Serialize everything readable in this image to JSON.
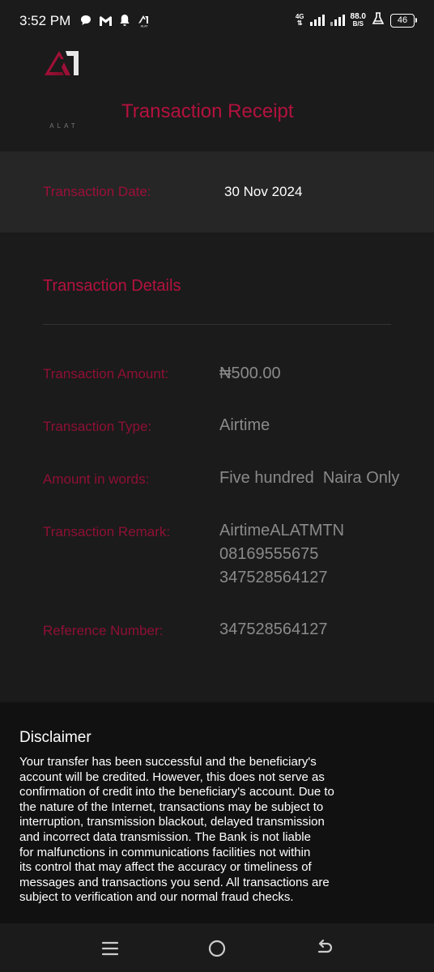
{
  "status_bar": {
    "time": "3:52 PM",
    "network": "4G",
    "speed_value": "88.0",
    "speed_unit": "B/S",
    "battery": "46",
    "left_icons": [
      "chat-bubble-icon",
      "gmail-icon",
      "notification-bell-icon",
      "alat-app-icon"
    ]
  },
  "header": {
    "logo_text": "ALAT",
    "title": "Transaction Receipt"
  },
  "date_section": {
    "label": "Transaction Date:",
    "value": "30 Nov 2024"
  },
  "details": {
    "title": "Transaction Details",
    "rows": [
      {
        "label": "Transaction Amount:",
        "value": "₦500.00"
      },
      {
        "label": "Transaction Type:",
        "value": "Airtime"
      },
      {
        "label": "Amount in words:",
        "value": "Five hundred  Naira Only"
      },
      {
        "label": "Transaction Remark:",
        "value_lines": [
          "AirtimeALATMTN",
          "08169555675",
          "347528564127"
        ]
      },
      {
        "label": "Reference Number:",
        "value": "347528564127"
      }
    ]
  },
  "disclaimer": {
    "title": "Disclaimer",
    "lines": [
      "Your transfer has been successful and the beneficiary's",
      "account will be credited. However, this does not serve as",
      "confirmation of credit into the beneficiary's account. Due to",
      "the nature of the Internet, transactions may be subject to",
      "interruption, transmission blackout, delayed transmission",
      "and incorrect data transmission. The Bank is not liable",
      "for malfunctions in communications facilities not within",
      "its control that may affect the accuracy or timeliness of",
      "messages and transactions you send. All transactions are",
      "subject to verification and our normal fraud checks."
    ]
  },
  "navbar": {
    "buttons": [
      "menu-icon",
      "home-icon",
      "back-icon"
    ]
  },
  "colors": {
    "accent": "#b3123e",
    "label": "#8e1034",
    "value": "#8a8a8a",
    "background": "#1b1b1b"
  }
}
